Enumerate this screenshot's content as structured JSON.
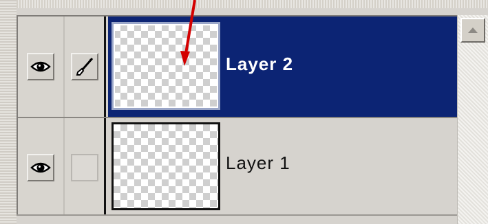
{
  "layers_panel": {
    "layers": [
      {
        "name": "Layer 2",
        "selected": true,
        "visible": true,
        "visibility_icon": "eye-icon",
        "link_icon": "paintbrush-icon"
      },
      {
        "name": "Layer 1",
        "selected": false,
        "visible": true,
        "visibility_icon": "eye-icon",
        "link_icon": ""
      }
    ],
    "scrollbar": {
      "up_icon": "triangle-up-icon"
    },
    "colors": {
      "selection": "#0c2474",
      "panel": "#d6d3ce",
      "annotation_arrow": "#d40000"
    }
  }
}
